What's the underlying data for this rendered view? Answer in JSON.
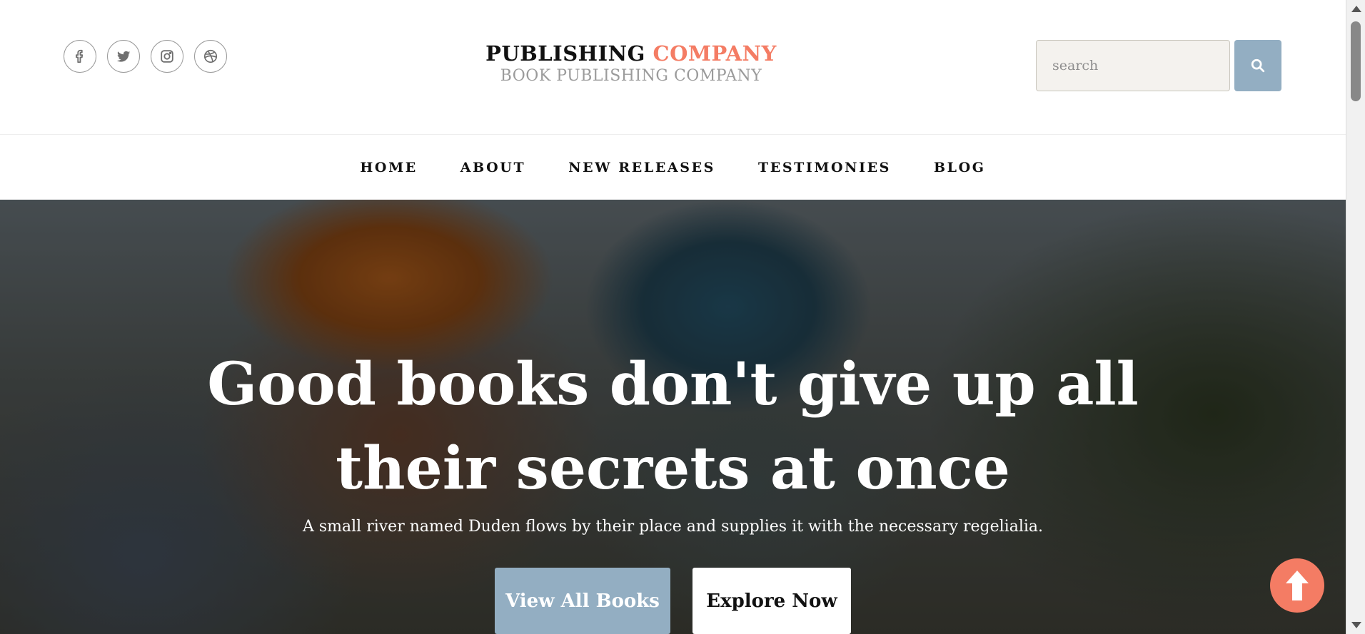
{
  "header": {
    "social": [
      {
        "name": "facebook-icon"
      },
      {
        "name": "twitter-icon"
      },
      {
        "name": "instagram-icon"
      },
      {
        "name": "dribbble-icon"
      }
    ],
    "brand_main": "PUBLISHING",
    "brand_accent": "COMPANY",
    "brand_sub": "BOOK PUBLISHING COMPANY",
    "search_placeholder": "search",
    "search_value": "",
    "search_icon": "search-icon"
  },
  "nav": {
    "items": [
      "HOME",
      "ABOUT",
      "NEW RELEASES",
      "TESTIMONIES",
      "BLOG"
    ]
  },
  "hero": {
    "headline": "Good books don't give up all their secrets at once",
    "subline": "A small river named Duden flows by their place and supplies it with the necessary regelialia.",
    "primary_button": "View All Books",
    "secondary_button": "Explore Now"
  },
  "back_to_top_icon": "arrow-up-icon",
  "colors": {
    "accent": "#f47c64",
    "button_blue": "#93aec2",
    "search_bg": "#f4f2ee"
  }
}
